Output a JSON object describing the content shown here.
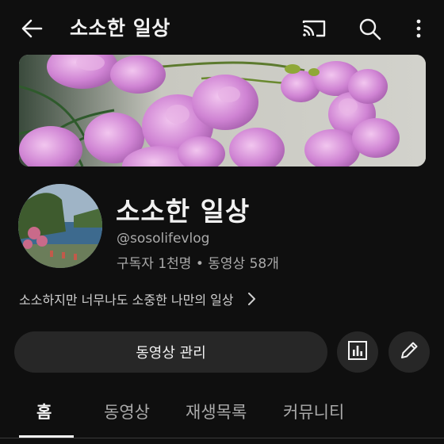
{
  "header": {
    "title": "소소한 일상",
    "icons": {
      "back": "arrow-left-icon",
      "cast": "cast-icon",
      "search": "search-icon",
      "more": "more-vertical-icon"
    }
  },
  "channel": {
    "name": "소소한 일상",
    "handle": "@sosolifevlog",
    "stats": "구독자 1천명 • 동영상 58개",
    "description": "소소하지만 너무나도 소중한 나만의 일상"
  },
  "actions": {
    "manage_label": "동영상 관리",
    "analytics_icon": "analytics-icon",
    "edit_icon": "pencil-icon"
  },
  "tabs": [
    {
      "label": "홈",
      "active": true
    },
    {
      "label": "동영상",
      "active": false
    },
    {
      "label": "재생목록",
      "active": false
    },
    {
      "label": "커뮤니티",
      "active": false
    }
  ],
  "colors": {
    "background": "#0f0f0f",
    "text_primary": "#f1f1f1",
    "text_secondary": "#aaaaaa",
    "button_bg": "#272727"
  }
}
